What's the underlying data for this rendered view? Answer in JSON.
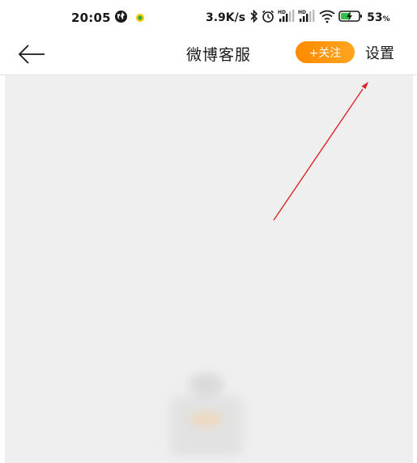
{
  "status_bar": {
    "time": "20:05",
    "left_icons": [
      "world-icon",
      "location-dot-icon"
    ],
    "net_speed": "3.9K/s",
    "right_icons": [
      "bluetooth-icon",
      "alarm-icon",
      "signal-hd-1-icon",
      "signal-hd-2-icon",
      "wifi-icon",
      "battery-charging-icon"
    ],
    "battery_percent": "53",
    "battery_unit": "%"
  },
  "nav": {
    "title": "微博客服",
    "follow_label": "+关注",
    "settings_label": "设置"
  },
  "colors": {
    "follow_button": "#ff9a0f",
    "content_background": "#efefef",
    "annotation_arrow": "#d9262a"
  }
}
